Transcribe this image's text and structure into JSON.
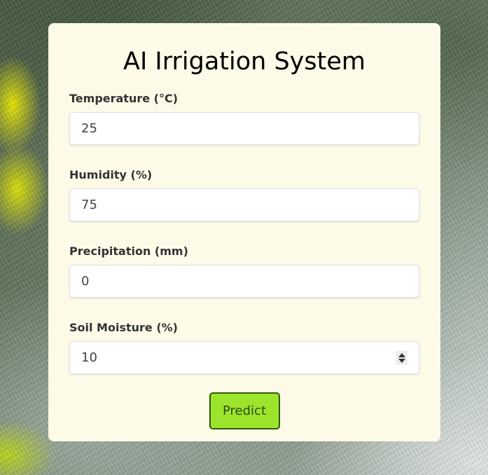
{
  "form": {
    "title": "AI Irrigation System",
    "fields": [
      {
        "label": "Temperature (°C)",
        "value": "25"
      },
      {
        "label": "Humidity (%)",
        "value": "75"
      },
      {
        "label": "Precipitation (mm)",
        "value": "0"
      },
      {
        "label": "Soil Moisture (%)",
        "value": "10"
      }
    ],
    "submit_label": "Predict"
  },
  "colors": {
    "card_background": "#fdfae8",
    "button_background": "#9ce52c",
    "button_border": "#2f5a0c"
  }
}
